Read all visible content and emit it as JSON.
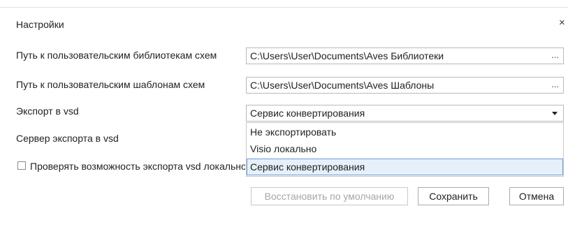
{
  "dialog": {
    "title": "Настройки",
    "close_glyph": "×"
  },
  "fields": {
    "libraries": {
      "label": "Путь к пользовательским библиотекам схем",
      "value": "C:\\Users\\User\\Documents\\Aves Библиотеки",
      "browse": "..."
    },
    "templates": {
      "label": "Путь к пользовательским шаблонам схем",
      "value": "C:\\Users\\User\\Documents\\Aves Шаблоны",
      "browse": "..."
    },
    "export": {
      "label": "Экспорт в vsd",
      "value": "Сервис конвертирования",
      "arrow_icon": "caret-down-icon"
    },
    "server": {
      "label": "Сервер экспорта в vsd"
    }
  },
  "dropdown": {
    "options": [
      "Не экспортировать",
      "Visio локально",
      "Сервис конвертирования"
    ],
    "selected": "Сервис конвертирования"
  },
  "checkbox": {
    "label": "Проверять возможность экспорта vsd локально",
    "checked": false
  },
  "buttons": {
    "restore": "Восстановить по умолчанию",
    "save": "Сохранить",
    "cancel": "Отмена"
  }
}
